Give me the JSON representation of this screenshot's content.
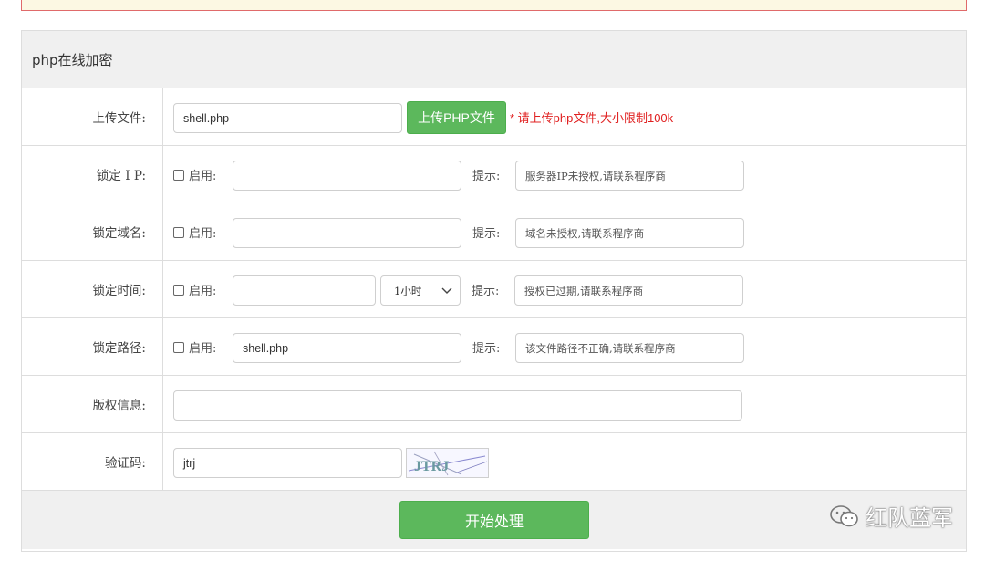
{
  "panel": {
    "title": "php在线加密"
  },
  "upload": {
    "label": "上传文件:",
    "value": "shell.php",
    "button": "上传PHP文件",
    "note": "* 请上传php文件,大小限制100k"
  },
  "lock_ip": {
    "label": "锁定 I P:",
    "enable": "启用:",
    "value": "",
    "hint_label": "提示:",
    "hint_value": "服务器IP未授权,请联系程序商"
  },
  "lock_domain": {
    "label": "锁定域名:",
    "enable": "启用:",
    "value": "",
    "hint_label": "提示:",
    "hint_value": "域名未授权,请联系程序商"
  },
  "lock_time": {
    "label": "锁定时间:",
    "enable": "启用:",
    "value": "",
    "select_value": "1小时",
    "hint_label": "提示:",
    "hint_value": "授权已过期,请联系程序商"
  },
  "lock_path": {
    "label": "锁定路径:",
    "enable": "启用:",
    "value": "shell.php",
    "hint_label": "提示:",
    "hint_value": "该文件路径不正确,请联系程序商"
  },
  "copyright": {
    "label": "版权信息:",
    "value": ""
  },
  "captcha": {
    "label": "验证码:",
    "value": "jtrj",
    "image_text": "JTRJ"
  },
  "submit": {
    "label": "开始处理"
  },
  "watermark": {
    "text": "红队蓝军"
  },
  "colors": {
    "accent_green": "#5cb85c",
    "note_red": "#e02020"
  }
}
